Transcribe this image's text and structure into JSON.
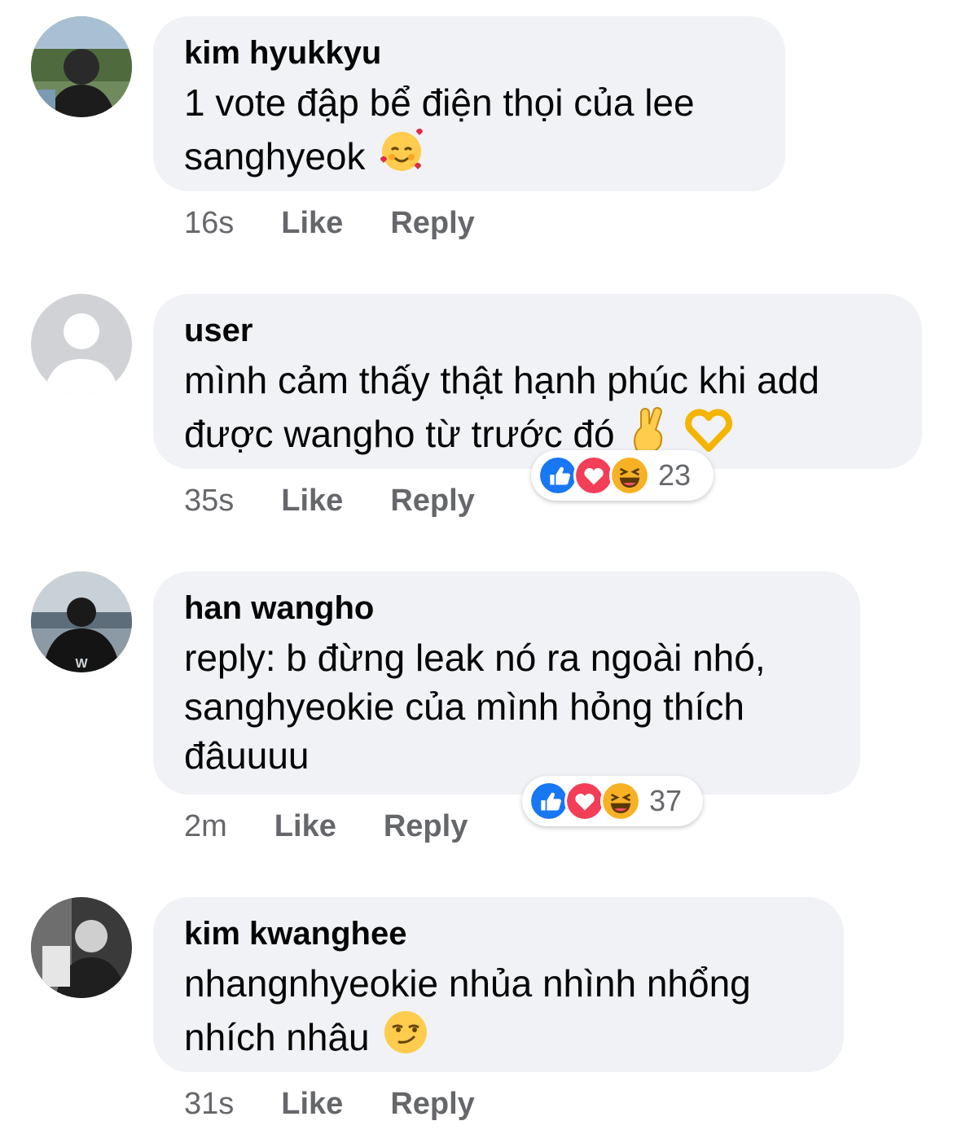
{
  "comments": [
    {
      "name": "kim hyukkyu",
      "text": "1 vote đập bể điện thọi của lee sanghyeok",
      "emoji": [
        "smiling-face-with-hearts"
      ],
      "time": "16s",
      "like_label": "Like",
      "reply_label": "Reply"
    },
    {
      "name": "user",
      "text": "mình cảm thấy thật hạnh phúc khi add được wangho từ trước đó",
      "emoji": [
        "crossed-fingers",
        "heart-hands"
      ],
      "time": "35s",
      "like_label": "Like",
      "reply_label": "Reply",
      "reactions": {
        "icons": [
          "like",
          "love",
          "haha"
        ],
        "count": "23"
      }
    },
    {
      "name": "han wangho",
      "text": "reply: b đừng leak nó ra ngoài nhó, sanghyeokie của mình hỏng thích đâuuuu",
      "time": "2m",
      "like_label": "Like",
      "reply_label": "Reply",
      "reactions": {
        "icons": [
          "like",
          "love",
          "haha"
        ],
        "count": "37"
      }
    },
    {
      "name": "kim kwanghee",
      "text": "nhangnhyeokie nhủa nhình nhổng nhích nhâu",
      "emoji": [
        "smirking-face"
      ],
      "time": "31s",
      "like_label": "Like",
      "reply_label": "Reply"
    }
  ],
  "colors": {
    "bubble": "#f0f2f5",
    "meta_text": "#65676b",
    "like_blue": "#1877f2",
    "love_red": "#f33e58",
    "haha_yellow": "#f7b125"
  }
}
